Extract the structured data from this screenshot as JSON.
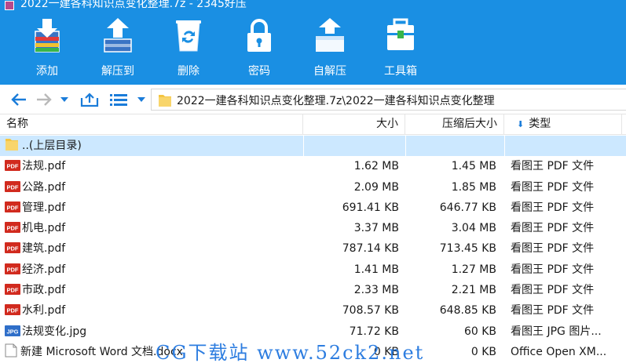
{
  "window": {
    "title": "2022一建各科知识点变化整理.7z - 2345好压"
  },
  "toolbar": {
    "items": [
      {
        "label": "添加",
        "icon": "add-archive-icon"
      },
      {
        "label": "解压到",
        "icon": "extract-to-icon"
      },
      {
        "label": "删除",
        "icon": "recycle-bin-icon"
      },
      {
        "label": "密码",
        "icon": "lock-icon"
      },
      {
        "label": "自解压",
        "icon": "self-extract-icon"
      },
      {
        "label": "工具箱",
        "icon": "toolbox-icon"
      }
    ]
  },
  "address": {
    "path": "2022一建各科知识点变化整理.7z\\2022一建各科知识点变化整理"
  },
  "columns": {
    "name": "名称",
    "size": "大小",
    "compressed": "压缩后大小",
    "type": "类型",
    "type_sort_glyph": "⬇"
  },
  "files": [
    {
      "name": "..(上层目录)",
      "size": "",
      "compressed": "",
      "type": "",
      "icon": "folder-icon",
      "selected": true
    },
    {
      "name": "法规.pdf",
      "size": "1.62 MB",
      "compressed": "1.45 MB",
      "type": "看图王 PDF 文件",
      "icon": "pdf-icon"
    },
    {
      "name": "公路.pdf",
      "size": "2.09 MB",
      "compressed": "1.85 MB",
      "type": "看图王 PDF 文件",
      "icon": "pdf-icon"
    },
    {
      "name": "管理.pdf",
      "size": "691.41 KB",
      "compressed": "646.77 KB",
      "type": "看图王 PDF 文件",
      "icon": "pdf-icon"
    },
    {
      "name": "机电.pdf",
      "size": "3.37 MB",
      "compressed": "3.04 MB",
      "type": "看图王 PDF 文件",
      "icon": "pdf-icon"
    },
    {
      "name": "建筑.pdf",
      "size": "787.14 KB",
      "compressed": "713.45 KB",
      "type": "看图王 PDF 文件",
      "icon": "pdf-icon"
    },
    {
      "name": "经济.pdf",
      "size": "1.41 MB",
      "compressed": "1.27 MB",
      "type": "看图王 PDF 文件",
      "icon": "pdf-icon"
    },
    {
      "name": "市政.pdf",
      "size": "2.33 MB",
      "compressed": "2.21 MB",
      "type": "看图王 PDF 文件",
      "icon": "pdf-icon"
    },
    {
      "name": "水利.pdf",
      "size": "708.57 KB",
      "compressed": "648.85 KB",
      "type": "看图王 PDF 文件",
      "icon": "pdf-icon"
    },
    {
      "name": "法规变化.jpg",
      "size": "71.72 KB",
      "compressed": "60 KB",
      "type": "看图王 JPG 图片...",
      "icon": "jpg-icon"
    },
    {
      "name": "新建 Microsoft Word 文档.docx",
      "size": "0 KB",
      "compressed": "0 KB",
      "type": "Office Open XM...",
      "icon": "docx-icon"
    }
  ],
  "watermark": {
    "text": "CG下载站 www.52ck2.net"
  },
  "colors": {
    "toolbar_bg": "#1a8fe3",
    "selected_row": "#cce8ff",
    "pdf_red": "#d12a1e",
    "watermark": "#2d7de0"
  }
}
